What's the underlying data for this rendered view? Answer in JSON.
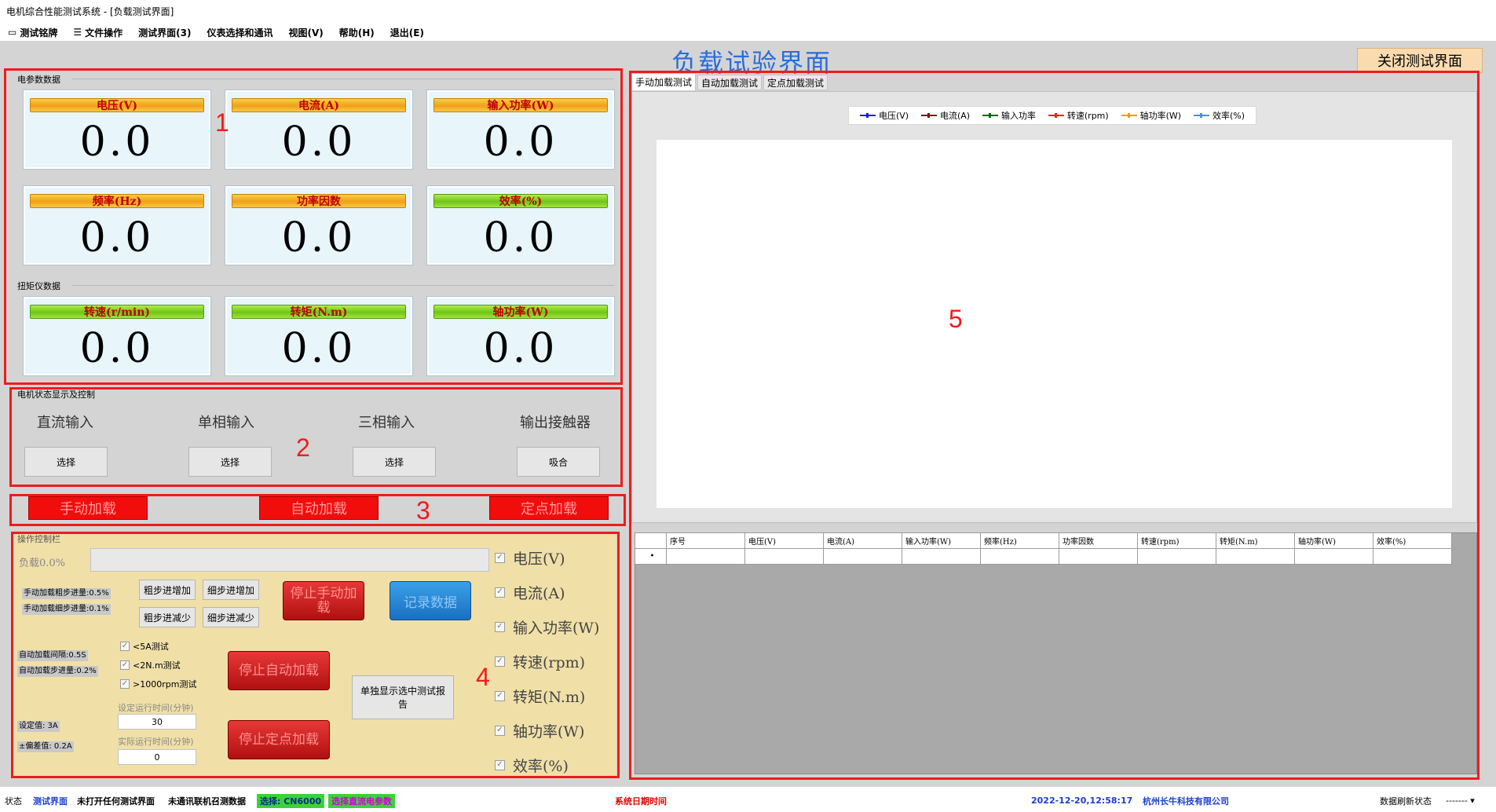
{
  "window": {
    "title": "电机综合性能测试系统 - [负载测试界面]"
  },
  "menu": [
    {
      "icon": "▭",
      "label": "测试铭牌"
    },
    {
      "icon": "☰",
      "label": "文件操作"
    },
    {
      "icon": "",
      "label": "测试界面(3)"
    },
    {
      "icon": "",
      "label": "仪表选择和通讯"
    },
    {
      "icon": "",
      "label": "视图(V)"
    },
    {
      "icon": "",
      "label": "帮助(H)"
    },
    {
      "icon": "",
      "label": "退出(E)"
    }
  ],
  "page": {
    "title": "负载试验界面",
    "close_label": "关闭测试界面"
  },
  "annotations": [
    "1",
    "2",
    "3",
    "4",
    "5"
  ],
  "electric": {
    "group_label": "电参数数据",
    "cards": [
      {
        "label": "电压(V)",
        "value": "0.0"
      },
      {
        "label": "电流(A)",
        "value": "0.0"
      },
      {
        "label": "输入功率(W)",
        "value": "0.0"
      },
      {
        "label": "频率(Hz)",
        "value": "0.0"
      },
      {
        "label": "功率因数",
        "value": "0.0"
      },
      {
        "label": "效率(%)",
        "value": "0.0"
      }
    ]
  },
  "torque": {
    "group_label": "扭矩仪数据",
    "cards": [
      {
        "label": "转速(r/min)",
        "value": "0.0"
      },
      {
        "label": "转矩(N.m)",
        "value": "0.0"
      },
      {
        "label": "轴功率(W)",
        "value": "0.0"
      }
    ]
  },
  "motor": {
    "group_label": "电机状态显示及控制",
    "items": [
      {
        "label": "直流输入",
        "button": "选择"
      },
      {
        "label": "单相输入",
        "button": "选择"
      },
      {
        "label": "三相输入",
        "button": "选择"
      },
      {
        "label": "输出接触器",
        "button": "吸合"
      }
    ]
  },
  "modes": [
    "手动加载",
    "自动加载",
    "定点加载"
  ],
  "ops": {
    "group_label": "操作控制栏",
    "load_text": "负载0.0%",
    "manual_coarse": "手动加载粗步进量:0.5%",
    "manual_fine": "手动加载细步进量:0.1%",
    "coarse_inc": "粗步进增加",
    "fine_inc": "细步进增加",
    "coarse_dec": "粗步进减少",
    "fine_dec": "细步进减少",
    "stop_manual": "停止手动加载",
    "record": "记录数据",
    "auto_interval": "自动加载间隔:0.5S",
    "auto_step": "自动加载步进量:0.2%",
    "checks": [
      "<5A测试",
      "<2N.m测试",
      ">1000rpm测试"
    ],
    "stop_auto": "停止自动加载",
    "single_report": "单独显示选中测试报告",
    "set_time_label": "设定运行时间(分钟)",
    "set_time_value": "30",
    "act_time_label": "实际运行时间(分钟)",
    "act_time_value": "0",
    "set_value": "设定值: 3A",
    "dev_value": "±偏差值: 0.2A",
    "stop_fixed": "停止定点加载",
    "series_checks": [
      "电压(V)",
      "电流(A)",
      "输入功率(W)",
      "转速(rpm)",
      "转矩(N.m)",
      "轴功率(W)",
      "效率(%)"
    ]
  },
  "chart_tabs": [
    "手动加载测试",
    "自动加载测试",
    "定点加载测试"
  ],
  "chart_data": {
    "type": "line",
    "series": [
      {
        "name": "电压(V)",
        "color": "#1a1aff",
        "values": []
      },
      {
        "name": "电流(A)",
        "color": "#7a1010",
        "values": []
      },
      {
        "name": "输入功率",
        "color": "#0a6b0a",
        "values": []
      },
      {
        "name": "转速(rpm)",
        "color": "#ff1a1a",
        "values": []
      },
      {
        "name": "轴功率(W)",
        "color": "#ff9900",
        "values": []
      },
      {
        "name": "效率(%)",
        "color": "#4a90e2",
        "values": []
      }
    ],
    "legend": "top-center"
  },
  "table": {
    "columns": [
      "",
      "序号",
      "电压(V)",
      "电流(A)",
      "输入功率(W)",
      "频率(Hz)",
      "功率因数",
      "转速(rpm)",
      "转矩(N.m)",
      "轴功率(W)",
      "效率(%)"
    ],
    "new_row_marker": "•"
  },
  "status": {
    "label": "状态",
    "interface": "测试界面",
    "msg1": "未打开任何测试界面",
    "msg2": "未通讯联机召测数据",
    "select_label": "选择: CN6000",
    "select_extra": "选择直流电参数",
    "datetime_label": "系统日期时间",
    "datetime": "2022-12-20,12:58:17",
    "company": "杭州长牛科技有限公司",
    "refresh_label": "数据刷新状态",
    "refresh_value": "------- ▾"
  },
  "colors": {
    "accent_blue": "#2b6cd9",
    "annotation_red": "#ee1c1c",
    "ops_bg": "#f0e0a8"
  }
}
